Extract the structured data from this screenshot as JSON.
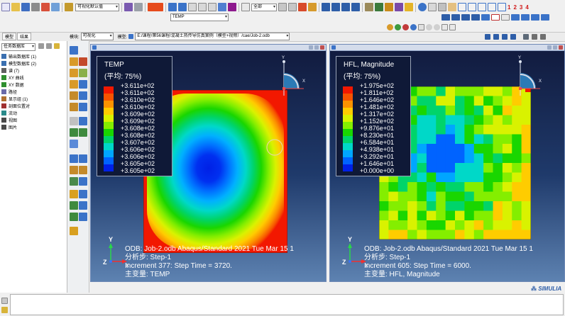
{
  "toolbar": {
    "row1_module_combo": "可视化默认值",
    "row1_part_combo": "全部",
    "row1_var_combo": "TEMP",
    "row1_numbers": [
      "1",
      "2",
      "3",
      "4"
    ]
  },
  "context_bar": {
    "tabs": [
      "模型",
      "结果"
    ],
    "module_label": "模块:",
    "module_value": "可视化",
    "model_label": "模型:",
    "model_path": "E:/课程/第56课程/混凝土热传导仿真案例（模型+视频）/cae/Job-2.odb"
  },
  "tree": {
    "filter_combo": "任务数据库",
    "items": [
      {
        "label": "输出数据库 (1)",
        "color": "#3a6fb0"
      },
      {
        "label": "模型数据库 (2)",
        "color": "#3a6fb0"
      },
      {
        "label": "谱 (7)",
        "color": "#606060"
      },
      {
        "label": "XY 曲线",
        "color": "#2f8f2f"
      },
      {
        "label": "XY 数据",
        "color": "#2f8f2f"
      },
      {
        "label": "路径",
        "color": "#6a6aa8"
      },
      {
        "label": "显示组 (1)",
        "color": "#b07030"
      },
      {
        "label": "剖面位置对",
        "color": "#a03030"
      },
      {
        "label": "流动",
        "color": "#2a8a8a"
      },
      {
        "label": "视图",
        "color": "#4a4a4a"
      },
      {
        "label": "图片",
        "color": "#4a4a4a"
      }
    ]
  },
  "viewports": [
    {
      "legend_title": "TEMP",
      "legend_sub": "(平均: 75%)",
      "legend_colors": [
        "#f21800",
        "#f75300",
        "#fc9200",
        "#ffcc00",
        "#d9f200",
        "#84ee00",
        "#19d600",
        "#00d46a",
        "#00d8c8",
        "#00a6ff",
        "#0063ff",
        "#0020e6"
      ],
      "legend_labels": [
        "+3.611e+02",
        "+3.611e+02",
        "+3.610e+02",
        "+3.610e+02",
        "+3.609e+02",
        "+3.609e+02",
        "+3.608e+02",
        "+3.608e+02",
        "+3.607e+02",
        "+3.606e+02",
        "+3.606e+02",
        "+3.605e+02",
        "+3.605e+02"
      ],
      "odb_line": "ODB: Job-2.odb    Abaqus/Standard 2021    Tue Mar 15 1",
      "step_line": "分析步: Step-1",
      "increment_line": "Increment    377: Step Time =    3720.",
      "var_line": "主变量: TEMP",
      "triad": {
        "x": "X",
        "y": "Y",
        "z": "Z"
      }
    },
    {
      "legend_title": "HFL, Magnitude",
      "legend_sub": "(平均: 75%)",
      "legend_colors": [
        "#f21800",
        "#f75300",
        "#fc9200",
        "#ffcc00",
        "#d9f200",
        "#84ee00",
        "#19d600",
        "#00d46a",
        "#00d8c8",
        "#00a6ff",
        "#0063ff",
        "#0020e6"
      ],
      "legend_labels": [
        "+1.975e+02",
        "+1.811e+02",
        "+1.646e+02",
        "+1.481e+02",
        "+1.317e+02",
        "+1.152e+02",
        "+9.876e+01",
        "+8.230e+01",
        "+6.584e+01",
        "+4.938e+01",
        "+3.292e+01",
        "+1.646e+01",
        "+0.000e+00"
      ],
      "odb_line": "ODB: Job-2.odb    Abaqus/Standard 2021    Tue Mar 15 1",
      "step_line": "分析步: Step-1",
      "increment_line": "Increment    605: Step Time =    6000.",
      "var_line": "主变量: HFL, Magnitude",
      "triad": {
        "x": "X",
        "y": "Y",
        "z": "Z"
      }
    }
  ],
  "brand": "SIMULIA",
  "colors": {
    "viewport_top": "#111a3d",
    "viewport_bottom": "#5d82b1",
    "accent_red": "#d01818"
  }
}
